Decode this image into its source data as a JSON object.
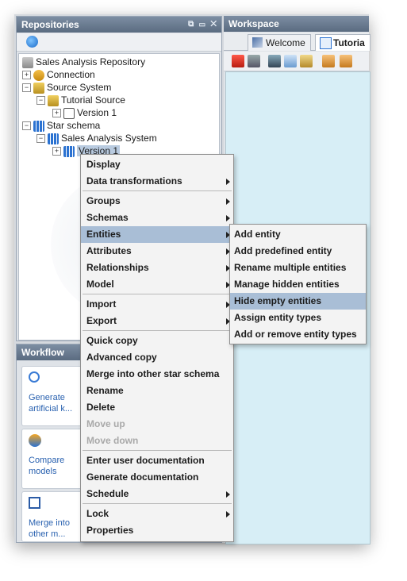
{
  "repositories": {
    "title": "Repositories",
    "title_buttons": "⧉ ▭ ✕",
    "tree": [
      {
        "label": "Sales Analysis Repository",
        "icon": "repository-icon"
      },
      {
        "label": "Connection",
        "icon": "connection-icon"
      },
      {
        "label": "Source System",
        "icon": "source-system-icon"
      },
      {
        "label": "Tutorial Source",
        "icon": "source-icon"
      },
      {
        "label": "Version 1",
        "icon": "version-icon"
      },
      {
        "label": "Star schema",
        "icon": "star-schema-icon"
      },
      {
        "label": "Sales Analysis System",
        "icon": "star-schema-icon"
      },
      {
        "label": "Version 1",
        "icon": "star-schema-icon"
      }
    ]
  },
  "workspace": {
    "title": "Workspace",
    "tabs": [
      {
        "label": "Welcome"
      },
      {
        "label": "Tutoria"
      }
    ]
  },
  "workflow": {
    "title": "Workflow",
    "cards": [
      {
        "label": "Generate artificial k..."
      },
      {
        "label": "Compare models"
      },
      {
        "label": "Merge into other m..."
      }
    ]
  },
  "context_menu": {
    "items": [
      {
        "label": "Display"
      },
      {
        "label": "Data transformations"
      },
      {
        "label": "Groups"
      },
      {
        "label": "Schemas"
      },
      {
        "label": "Entities"
      },
      {
        "label": "Attributes"
      },
      {
        "label": "Relationships"
      },
      {
        "label": "Model"
      },
      {
        "label": "Import"
      },
      {
        "label": "Export"
      },
      {
        "label": "Quick copy"
      },
      {
        "label": "Advanced copy"
      },
      {
        "label": "Merge into other star schema"
      },
      {
        "label": "Rename"
      },
      {
        "label": "Delete"
      },
      {
        "label": "Move up"
      },
      {
        "label": "Move down"
      },
      {
        "label": "Enter user documentation"
      },
      {
        "label": "Generate documentation"
      },
      {
        "label": "Schedule"
      },
      {
        "label": "Lock"
      },
      {
        "label": "Properties"
      }
    ]
  },
  "entities_submenu": {
    "items": [
      {
        "label": "Add entity"
      },
      {
        "label": "Add predefined entity"
      },
      {
        "label": "Rename multiple entities"
      },
      {
        "label": "Manage hidden entities"
      },
      {
        "label": "Hide empty entities"
      },
      {
        "label": "Assign entity types"
      },
      {
        "label": "Add or remove entity types"
      }
    ]
  },
  "colors": {
    "title_bar": "#5a6b80",
    "menu_highlight": "#a9bed6",
    "canvas": "#d7eef6",
    "workflow_link": "#2a62b0"
  }
}
